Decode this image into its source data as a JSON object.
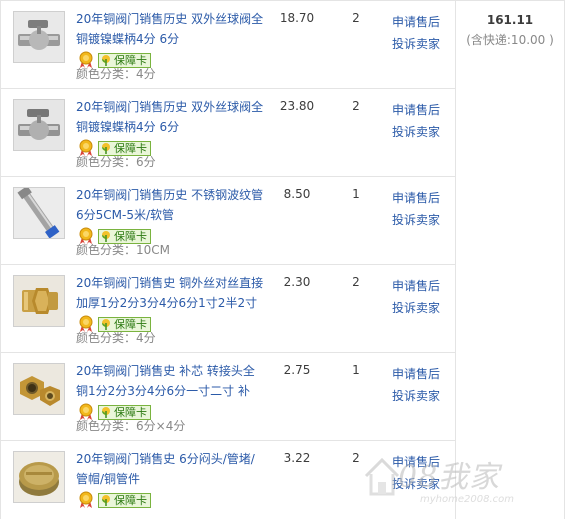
{
  "order": {
    "items": [
      {
        "title": "20年铜阀门销售历史 双外丝球阀全铜镀镍蝶柄4分 6分",
        "guarantee_label": "保障卡",
        "color_label": "颜色分类：",
        "color_value": "4分",
        "price": "18.70",
        "qty": "2",
        "action_refund": "申请售后",
        "action_complain": "投诉卖家",
        "thumb_icon": "ball-valve-icon"
      },
      {
        "title": "20年铜阀门销售历史 双外丝球阀全铜镀镍蝶柄4分 6分",
        "guarantee_label": "保障卡",
        "color_label": "颜色分类：",
        "color_value": "6分",
        "price": "23.80",
        "qty": "2",
        "action_refund": "申请售后",
        "action_complain": "投诉卖家",
        "thumb_icon": "ball-valve-icon"
      },
      {
        "title": "20年铜阀门销售历史 不锈钢波纹管6分5CM-5米/软管",
        "guarantee_label": "保障卡",
        "color_label": "颜色分类：",
        "color_value": "10CM",
        "price": "8.50",
        "qty": "1",
        "action_refund": "申请售后",
        "action_complain": "投诉卖家",
        "thumb_icon": "flex-hose-icon"
      },
      {
        "title": "20年铜阀门销售史 铜外丝对丝直接加厚1分2分3分4分6分1寸2半2寸",
        "guarantee_label": "保障卡",
        "color_label": "颜色分类：",
        "color_value": "4分",
        "price": "2.30",
        "qty": "2",
        "action_refund": "申请售后",
        "action_complain": "投诉卖家",
        "thumb_icon": "brass-nipple-icon"
      },
      {
        "title": "20年铜阀门销售史 补芯 转接头全铜1分2分3分4分6分一寸二寸 补",
        "guarantee_label": "保障卡",
        "color_label": "颜色分类：",
        "color_value": "6分×4分",
        "price": "2.75",
        "qty": "1",
        "action_refund": "申请售后",
        "action_complain": "投诉卖家",
        "thumb_icon": "brass-bushing-icon"
      },
      {
        "title": "20年铜阀门销售史 6分闷头/管堵/管帽/铜管件",
        "guarantee_label": "保障卡",
        "color_label": "",
        "color_value": "",
        "price": "3.22",
        "qty": "2",
        "action_refund": "申请售后",
        "action_complain": "投诉卖家",
        "thumb_icon": "pipe-cap-icon"
      }
    ],
    "total_amount": "161.11",
    "shipping_note": "(含快递:10.00 )"
  },
  "watermark": {
    "big": "08我家",
    "small": "myhome2008.com"
  },
  "colors": {
    "link": "#2b5aa8",
    "border": "#e4e4e4",
    "guarantee_green": "#2d7a13"
  }
}
